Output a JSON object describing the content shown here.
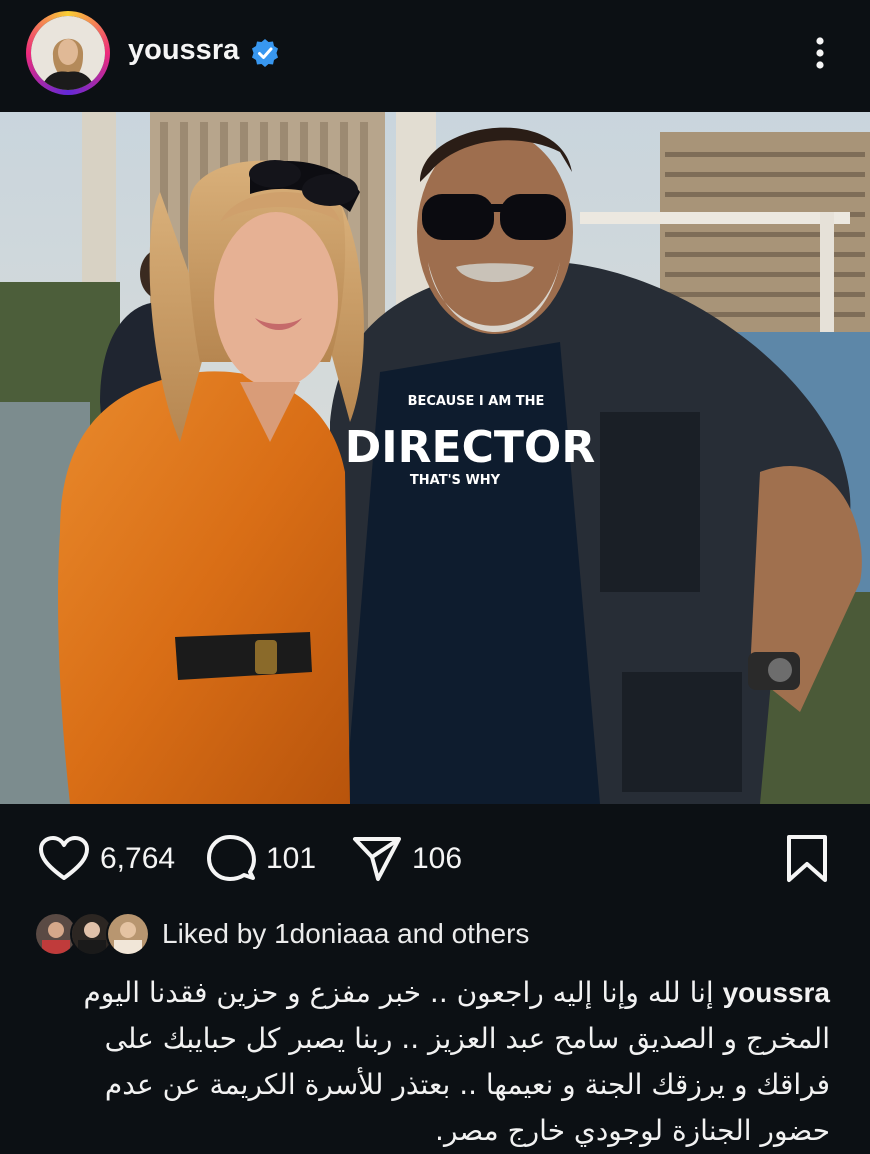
{
  "header": {
    "username": "youssra",
    "verified_icon": "verified-badge-icon",
    "more_icon": "more-vertical-icon"
  },
  "photo": {
    "shirt_line1": "BECAUSE I AM THE",
    "shirt_line2": "DIRECTOR",
    "shirt_line3": "THAT'S WHY"
  },
  "actions": {
    "likes_count": "6,764",
    "comments_count": "101",
    "shares_count": "106",
    "icons": [
      "heart-icon",
      "comment-icon",
      "share-icon",
      "bookmark-icon"
    ]
  },
  "liked_by": {
    "prefix": "Liked by",
    "user": "1doniaaa",
    "suffix": "and others"
  },
  "caption": {
    "username": "youssra",
    "text": "إنا لله وإنا إليه راجعون .. خبر مفزع و حزين فقدنا اليوم المخرج و الصديق سامح عبد العزيز .. ربنا يصبر كل حبايبك على فراقك و يرزقك الجنة و نعيمها .. بعتذر للأسرة الكريمة عن عدم حضور الجنازة لوجودي خارج مصر."
  },
  "colors": {
    "background": "#0c1014",
    "verified": "#3897f0",
    "text": "#f5f5f5"
  }
}
